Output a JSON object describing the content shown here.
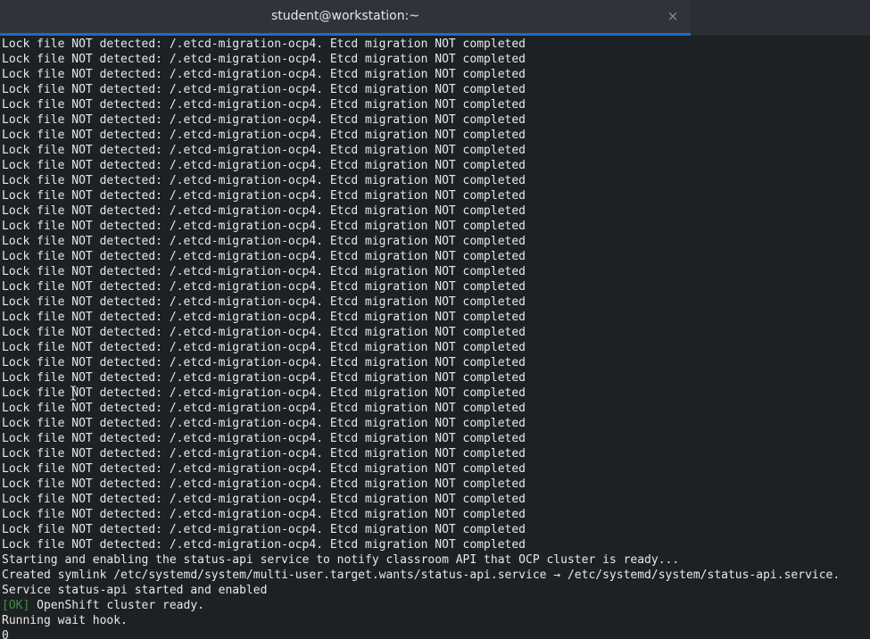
{
  "window": {
    "title": "student@workstation:~",
    "close_label": "×"
  },
  "terminal": {
    "lock_message": "Lock file NOT detected: /.etcd-migration-ocp4. Etcd migration NOT completed",
    "lock_repeat": 34,
    "tail_lines": [
      {
        "text": "Starting and enabling the status-api service to notify classroom API that OCP cluster is ready..."
      },
      {
        "text": "Created symlink /etc/systemd/system/multi-user.target.wants/status-api.service → /etc/systemd/system/status-api.service."
      },
      {
        "text": "Service status-api started and enabled"
      },
      {
        "prefix": "[OK]",
        "text": " OpenShift cluster ready."
      },
      {
        "text": "Running wait hook."
      },
      {
        "text": "0"
      }
    ]
  },
  "colors": {
    "background": "#1e2124",
    "foreground": "#e8e8e8",
    "ok": "#3f8f3f",
    "tab_accent": "#1c6dc9"
  },
  "icons": {
    "cursor": "text-cursor-icon"
  }
}
